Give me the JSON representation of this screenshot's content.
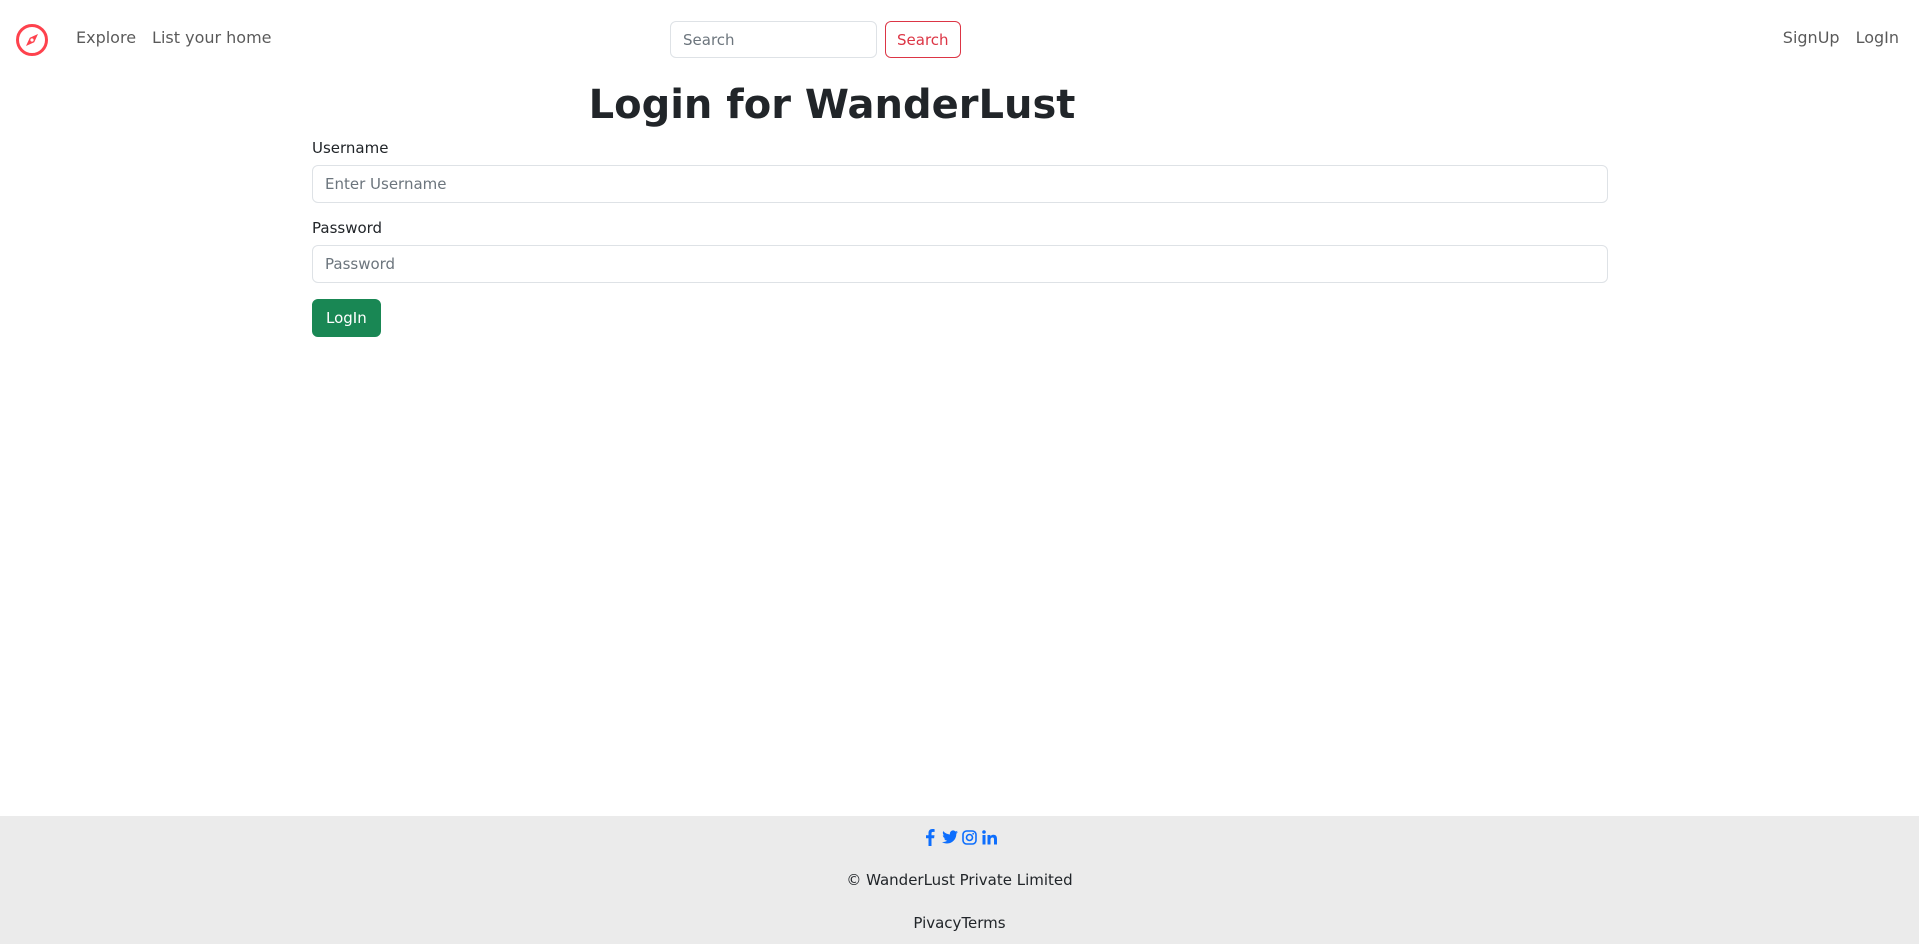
{
  "colors": {
    "brand": "#fe424d",
    "search_button": "#dc3545",
    "login_button": "#198754",
    "footer_bg": "#ebebeb",
    "social_icon": "#0d6efd"
  },
  "navbar": {
    "logo_icon": "compass-icon",
    "left_links": [
      "Explore",
      "List your home"
    ],
    "search": {
      "placeholder": "Search",
      "button_label": "Search"
    },
    "right_links": [
      "SignUp",
      "LogIn"
    ]
  },
  "main": {
    "title": "Login for WanderLust",
    "form": {
      "username_label": "Username",
      "username_placeholder": "Enter Username",
      "password_label": "Password",
      "password_placeholder": "Password",
      "submit_label": "LogIn"
    }
  },
  "footer": {
    "social_icons": [
      "facebook-icon",
      "twitter-icon",
      "instagram-icon",
      "linkedin-icon"
    ],
    "copyright": "© WanderLust Private Limited",
    "links": [
      "Pivacy",
      "Terms"
    ]
  }
}
